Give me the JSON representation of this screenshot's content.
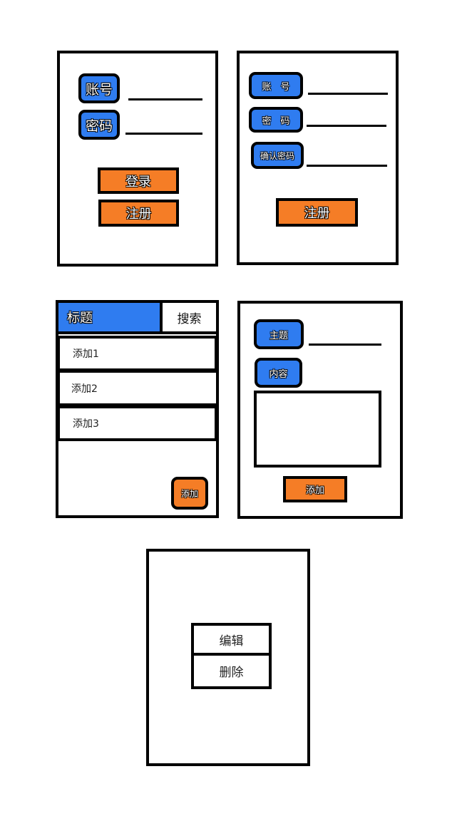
{
  "login": {
    "account_label": "账号",
    "password_label": "密码",
    "login_button": "登录",
    "register_button": "注册"
  },
  "register": {
    "account_label": "账　号",
    "password_label": "密　码",
    "confirm_label": "确认密码",
    "register_button": "注册"
  },
  "list": {
    "title": "标题",
    "search": "搜索",
    "items": [
      {
        "label": "添加1"
      },
      {
        "label": "添加2"
      },
      {
        "label": "添加3"
      }
    ],
    "add_button": "添加"
  },
  "add_form": {
    "subject_label": "主题",
    "content_label": "内容",
    "add_button": "添加"
  },
  "context_menu": {
    "edit": "编辑",
    "delete": "删除"
  },
  "colors": {
    "accent_blue": "#2f7cf0",
    "button_orange": "#f57d26",
    "outline": "#000000"
  }
}
